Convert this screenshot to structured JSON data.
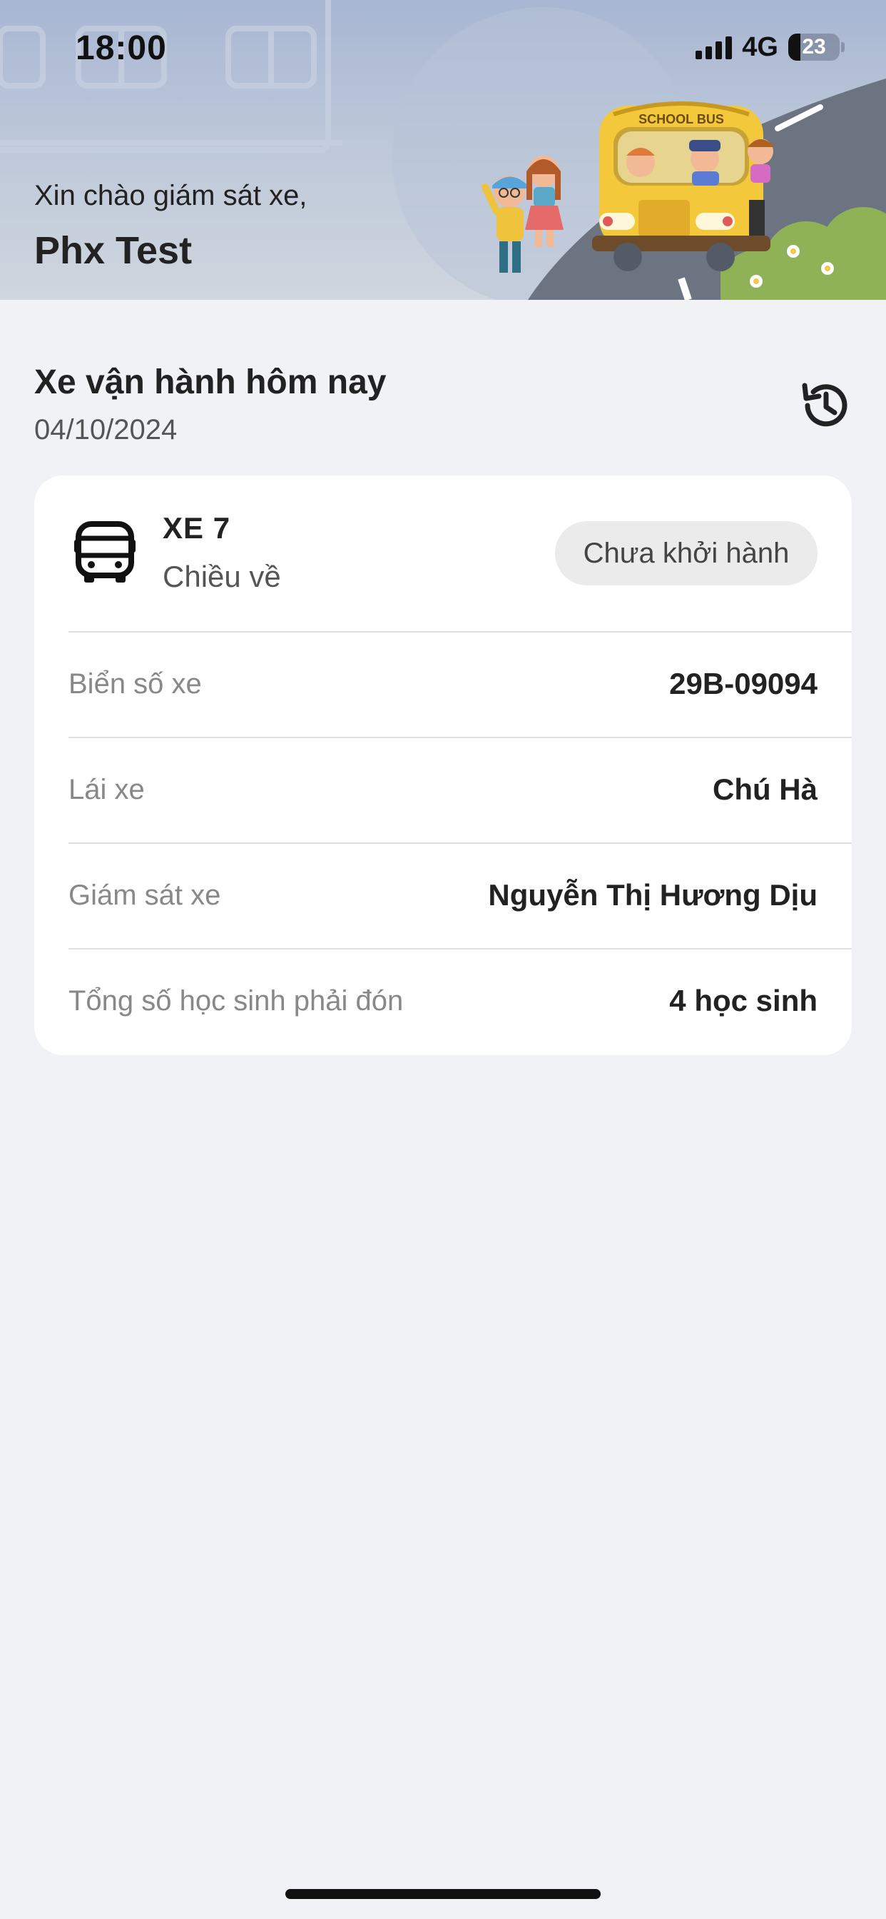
{
  "status_bar": {
    "time": "18:00",
    "network": "4G",
    "battery_percent": "23",
    "battery_level": 0.23,
    "signal_bars": 4
  },
  "header": {
    "greeting": "Xin chào giám sát xe,",
    "user_name": "Phx Test",
    "illustration_text": "SCHOOL BUS"
  },
  "section": {
    "title": "Xe vận hành hôm nay",
    "date": "04/10/2024",
    "history_icon": "history-icon"
  },
  "vehicle": {
    "icon": "bus-icon",
    "name": "XE 7",
    "direction": "Chiều về",
    "status": "Chưa khởi hành",
    "details": [
      {
        "label": "Biển số xe",
        "value": "29B-09094"
      },
      {
        "label": "Lái xe",
        "value": "Chú Hà"
      },
      {
        "label": "Giám sát xe",
        "value": "Nguyễn Thị Hương Dịu"
      },
      {
        "label": "Tổng số học sinh phải đón",
        "value": "4 học sinh"
      }
    ]
  },
  "colors": {
    "background": "#f1f2f6",
    "card": "#ffffff",
    "badge": "#ebebec",
    "bus_yellow": "#f3c93b",
    "text_primary": "#222222",
    "text_secondary": "#888888"
  }
}
